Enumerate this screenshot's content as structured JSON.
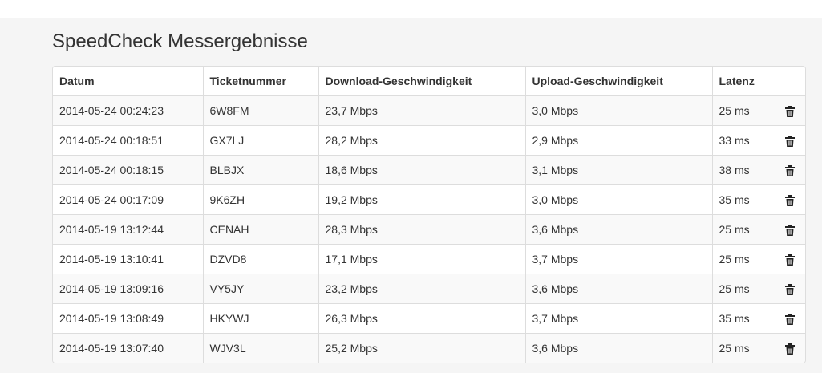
{
  "page": {
    "title": "SpeedCheck Messergebnisse"
  },
  "table": {
    "columns": [
      "Datum",
      "Ticketnummer",
      "Download-Geschwindigkeit",
      "Upload-Geschwindigkeit",
      "Latenz",
      ""
    ],
    "rows": [
      {
        "datum": "2014-05-24 00:24:23",
        "ticket": "6W8FM",
        "download": "23,7 Mbps",
        "upload": "3,0 Mbps",
        "latenz": "25 ms"
      },
      {
        "datum": "2014-05-24 00:18:51",
        "ticket": "GX7LJ",
        "download": "28,2 Mbps",
        "upload": "2,9 Mbps",
        "latenz": "33 ms"
      },
      {
        "datum": "2014-05-24 00:18:15",
        "ticket": "BLBJX",
        "download": "18,6 Mbps",
        "upload": "3,1 Mbps",
        "latenz": "38 ms"
      },
      {
        "datum": "2014-05-24 00:17:09",
        "ticket": "9K6ZH",
        "download": "19,2 Mbps",
        "upload": "3,0 Mbps",
        "latenz": "35 ms"
      },
      {
        "datum": "2014-05-19 13:12:44",
        "ticket": "CENAH",
        "download": "28,3 Mbps",
        "upload": "3,6 Mbps",
        "latenz": "25 ms"
      },
      {
        "datum": "2014-05-19 13:10:41",
        "ticket": "DZVD8",
        "download": "17,1 Mbps",
        "upload": "3,7 Mbps",
        "latenz": "25 ms"
      },
      {
        "datum": "2014-05-19 13:09:16",
        "ticket": "VY5JY",
        "download": "23,2 Mbps",
        "upload": "3,6 Mbps",
        "latenz": "25 ms"
      },
      {
        "datum": "2014-05-19 13:08:49",
        "ticket": "HKYWJ",
        "download": "26,3 Mbps",
        "upload": "3,7 Mbps",
        "latenz": "35 ms"
      },
      {
        "datum": "2014-05-19 13:07:40",
        "ticket": "WJV3L",
        "download": "25,2 Mbps",
        "upload": "3,6 Mbps",
        "latenz": "25 ms"
      }
    ],
    "row_action_icon": "trash-icon"
  },
  "colors": {
    "background": "#f5f5f5",
    "border": "#dddddd",
    "stripe": "#f9f9f9",
    "text": "#333333"
  }
}
